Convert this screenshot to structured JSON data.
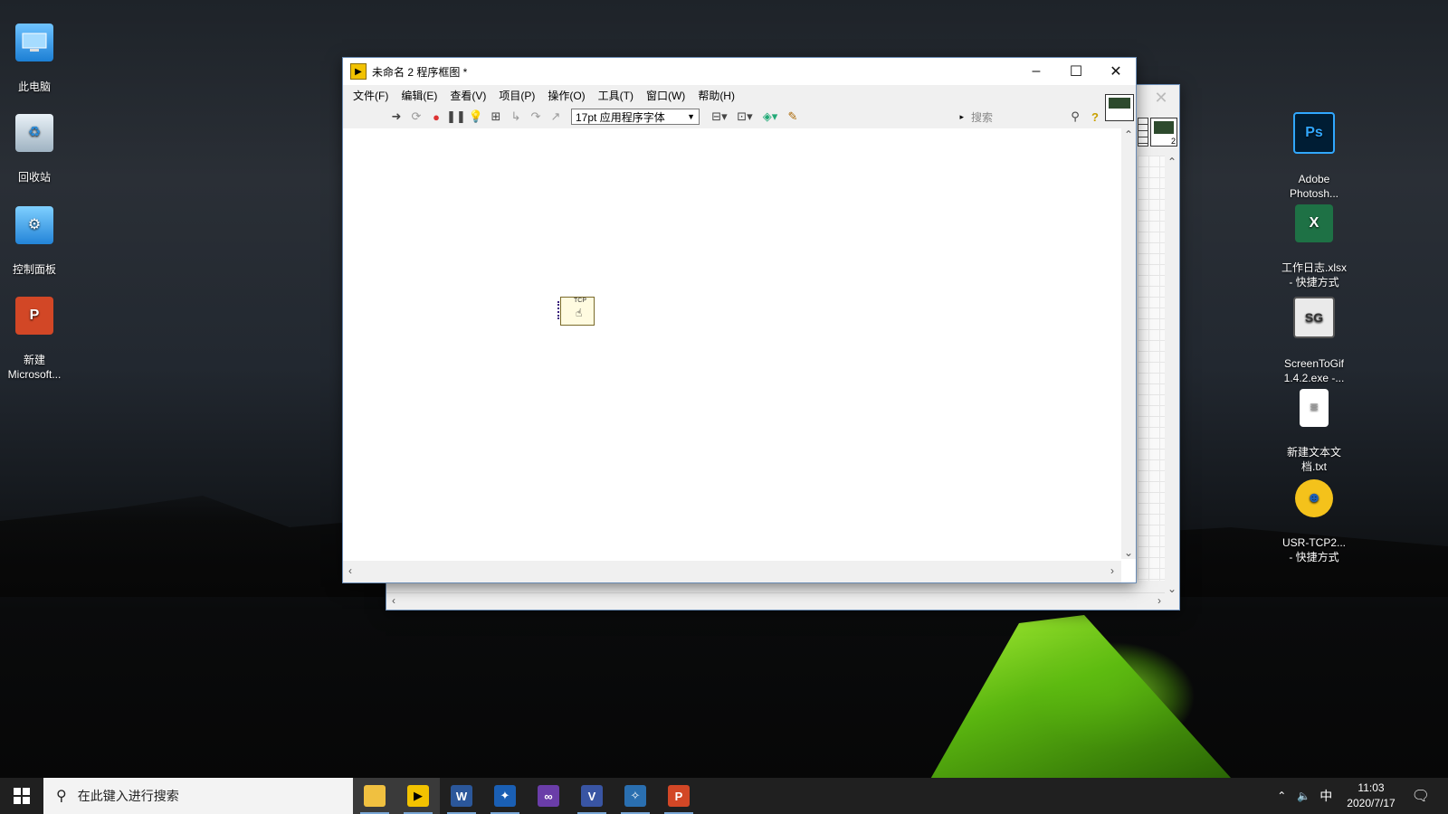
{
  "desktop": {
    "left_icons": [
      {
        "label": "此电脑"
      },
      {
        "label": "回收站"
      },
      {
        "label": "控制面板"
      },
      {
        "label": "新建\nMicrosoft..."
      }
    ],
    "right_icons": [
      {
        "label": "Adobe\nPhotosh..."
      },
      {
        "label": "工作日志.xlsx\n- 快捷方式"
      },
      {
        "label": "ScreenToGif\n1.4.2.exe -..."
      },
      {
        "label": "新建文本文\n档.txt"
      },
      {
        "label": "USR-TCP2...\n- 快捷方式"
      }
    ]
  },
  "main_window": {
    "title": "未命名 2 程序框图 *",
    "menu": [
      "文件(F)",
      "编辑(E)",
      "查看(V)",
      "项目(P)",
      "操作(O)",
      "工具(T)",
      "窗口(W)",
      "帮助(H)"
    ],
    "font_select": "17pt 应用程序字体",
    "search_placeholder": "搜索",
    "node_label": "TCP"
  },
  "back_window": {
    "badge": "2"
  },
  "taskbar": {
    "search_placeholder": "在此键入进行搜索",
    "tray_ime": "中",
    "time": "11:03",
    "date": "2020/7/17"
  },
  "colors": {
    "taskbar": "#202020",
    "window_border": "#6a8cb5",
    "accent": "#7aa7d6"
  }
}
